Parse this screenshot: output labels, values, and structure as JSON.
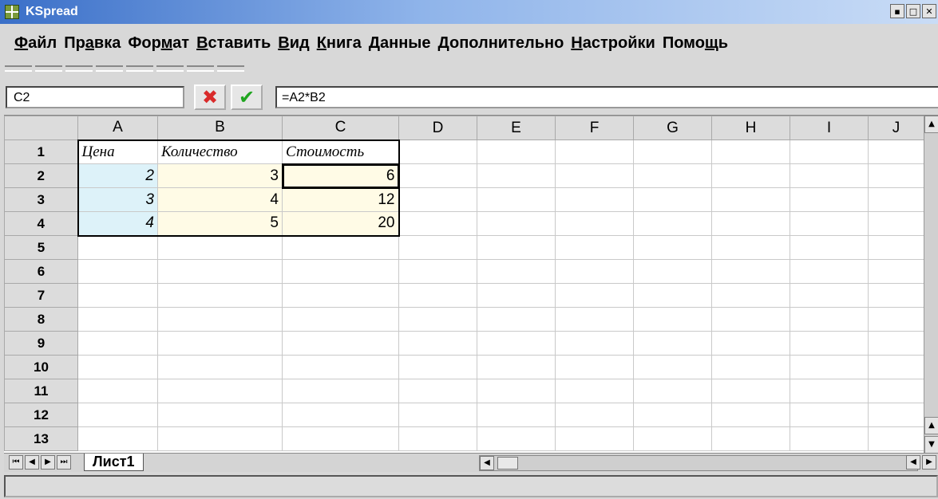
{
  "window": {
    "title": "KSpread"
  },
  "menu": [
    {
      "label": "Файл",
      "underline": 0
    },
    {
      "label": "Правка",
      "underline": 2
    },
    {
      "label": "Формат",
      "underline": 3
    },
    {
      "label": "Вставить",
      "underline": 0
    },
    {
      "label": "Вид",
      "underline": 0
    },
    {
      "label": "Книга",
      "underline": 0
    },
    {
      "label": "Данные",
      "underline": -1
    },
    {
      "label": "Дополнительно",
      "underline": -1
    },
    {
      "label": "Настройки",
      "underline": 0
    },
    {
      "label": "Помощь",
      "underline": 4
    }
  ],
  "formula_bar": {
    "cell_ref": "C2",
    "cancel_icon": "cancel-x-icon",
    "ok_icon": "check-icon",
    "formula": "=A2*B2"
  },
  "sheet": {
    "columns": [
      "A",
      "B",
      "C",
      "D",
      "E",
      "F",
      "G",
      "H",
      "I",
      "J"
    ],
    "rows": [
      "1",
      "2",
      "3",
      "4",
      "5",
      "6",
      "7",
      "8",
      "9",
      "10",
      "11",
      "12",
      "13"
    ],
    "cells": {
      "A1": "Цена",
      "B1": "Количество",
      "C1": "Стоимость",
      "A2": "2",
      "B2": "3",
      "C2": "6",
      "A3": "3",
      "B3": "4",
      "C3": "12",
      "A4": "4",
      "B4": "5",
      "C4": "20"
    },
    "selected_cell": "C2",
    "colors": {
      "column_a": "#ddf2f9",
      "columns_bc": "#fffbe6"
    }
  },
  "tabs": [
    {
      "label": "Лист1"
    }
  ]
}
